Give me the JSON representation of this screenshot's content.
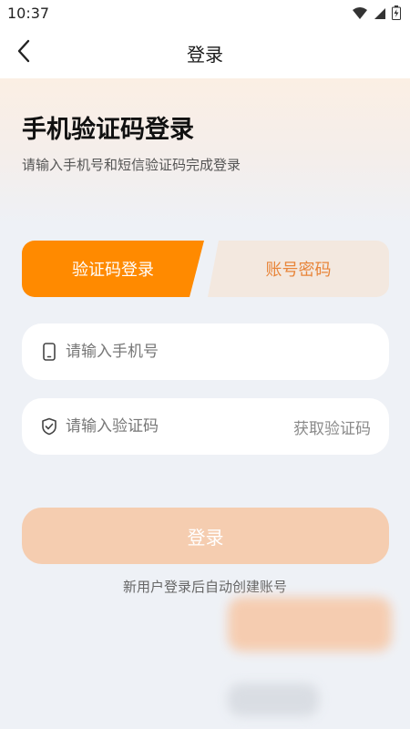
{
  "status_bar": {
    "time": "10:37"
  },
  "app_bar": {
    "back_icon": "chevron-left-icon",
    "title": "登录"
  },
  "hero": {
    "heading": "手机验证码登录",
    "subtitle": "请输入手机号和短信验证码完成登录"
  },
  "tabs": [
    {
      "label": "验证码登录",
      "active": true
    },
    {
      "label": "账号密码",
      "active": false
    }
  ],
  "form": {
    "phone": {
      "icon": "phone-icon",
      "placeholder": "请输入手机号",
      "value": ""
    },
    "code": {
      "icon": "shield-icon",
      "placeholder": "请输入验证码",
      "value": "",
      "get_code_label": "获取验证码"
    }
  },
  "login_button": {
    "label": "登录"
  },
  "hint": "新用户登录后自动创建账号",
  "colors": {
    "accent": "#ff8a00",
    "accent_soft": "#f3e8df",
    "login_disabled": "#f5cdb0",
    "background": "#eef1f6"
  }
}
